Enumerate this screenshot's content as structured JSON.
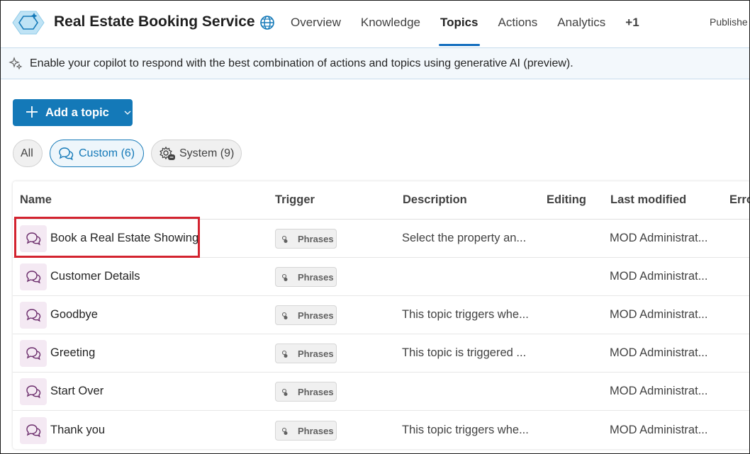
{
  "header": {
    "title": "Real Estate Booking Service",
    "tabs": [
      {
        "label": "Overview",
        "active": false
      },
      {
        "label": "Knowledge",
        "active": false
      },
      {
        "label": "Topics",
        "active": true
      },
      {
        "label": "Actions",
        "active": false
      },
      {
        "label": "Analytics",
        "active": false
      }
    ],
    "more_label": "+1",
    "status": "Publishe"
  },
  "banner": {
    "text": "Enable your copilot to respond with the best combination of actions and topics using generative AI (preview)."
  },
  "toolbar": {
    "add_label": "Add a topic"
  },
  "filters": {
    "all": "All",
    "custom": "Custom (6)",
    "system": "System (9)"
  },
  "table": {
    "headers": {
      "name": "Name",
      "trigger": "Trigger",
      "description": "Description",
      "editing": "Editing",
      "modified": "Last modified",
      "errors": "Erro"
    },
    "rows": [
      {
        "name": "Book a Real Estate Showing",
        "trigger": "Phrases",
        "description": "Select the property an...",
        "modified": "MOD Administrat..."
      },
      {
        "name": "Customer Details",
        "trigger": "Phrases",
        "description": "",
        "modified": "MOD Administrat..."
      },
      {
        "name": "Goodbye",
        "trigger": "Phrases",
        "description": "This topic triggers whe...",
        "modified": "MOD Administrat..."
      },
      {
        "name": "Greeting",
        "trigger": "Phrases",
        "description": "This topic is triggered ...",
        "modified": "MOD Administrat..."
      },
      {
        "name": "Start Over",
        "trigger": "Phrases",
        "description": "",
        "modified": "MOD Administrat..."
      },
      {
        "name": "Thank you",
        "trigger": "Phrases",
        "description": "This topic triggers whe...",
        "modified": "MOD Administrat..."
      }
    ]
  },
  "colors": {
    "accent": "#1479b8",
    "highlight": "#d3232f",
    "topic_icon_bg": "#f4e9f3"
  },
  "icons": {
    "logo": "copilot-hexagon-icon",
    "globe": "globe-icon",
    "banner": "sparkle-icon",
    "add": "plus-icon",
    "custom": "chat-bubbles-icon",
    "system": "gear-chat-icon",
    "topic": "chat-bubbles-icon",
    "trigger": "phrases-icon"
  }
}
